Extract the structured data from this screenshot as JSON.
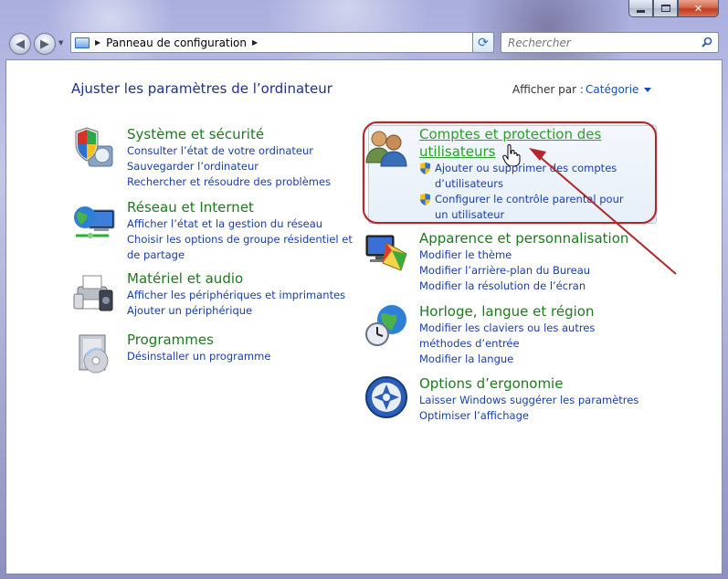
{
  "window": {
    "caption_buttons": {
      "minimize_icon": "minimize-icon",
      "maximize_icon": "maximize-icon",
      "close_icon": "close-icon"
    }
  },
  "nav": {
    "back_icon": "back-arrow-icon",
    "forward_icon": "forward-arrow-icon",
    "breadcrumb": [
      "Panneau de configuration"
    ],
    "search_placeholder": "Rechercher"
  },
  "header": {
    "title": "Ajuster les paramètres de l’ordinateur",
    "view_by_label": "Afficher par :",
    "view_by_value": "Catégorie"
  },
  "categories": {
    "system": {
      "icon": "shield-security-icon",
      "title": "Système et sécurité",
      "links": [
        "Consulter l’état de votre ordinateur",
        "Sauvegarder l’ordinateur",
        "Rechercher et résoudre des problèmes"
      ]
    },
    "network": {
      "icon": "network-globe-icon",
      "title": "Réseau et Internet",
      "links": [
        "Afficher l’état et la gestion du réseau",
        "Choisir les options de groupe résidentiel et de partage"
      ]
    },
    "hardware": {
      "icon": "printer-audio-icon",
      "title": "Matériel et audio",
      "links": [
        "Afficher les périphériques et imprimantes",
        "Ajouter un périphérique"
      ]
    },
    "programs": {
      "icon": "programs-disc-icon",
      "title": "Programmes",
      "links": [
        "Désinstaller un programme"
      ]
    },
    "accounts": {
      "icon": "user-accounts-icon",
      "title": "Comptes et protection des utilisateurs",
      "links": [
        "Ajouter ou supprimer des comptes d’utilisateurs",
        "Configurer le contrôle parental pour un utilisateur"
      ]
    },
    "appearance": {
      "icon": "appearance-monitor-icon",
      "title": "Apparence et personnalisation",
      "links": [
        "Modifier le thème",
        "Modifier l’arrière-plan du Bureau",
        "Modifier la résolution de l’écran"
      ]
    },
    "clock": {
      "icon": "clock-globe-icon",
      "title": "Horloge, langue et région",
      "links": [
        "Modifier les claviers ou les autres méthodes d’entrée",
        "Modifier la langue"
      ]
    },
    "ease": {
      "icon": "ease-of-access-icon",
      "title": "Options d’ergonomie",
      "links": [
        "Laisser Windows suggérer les paramètres",
        "Optimiser l’affichage"
      ]
    }
  },
  "colors": {
    "category_title": "#1e7a1e",
    "link": "#1a3ea8",
    "annotation": "#b3262c"
  }
}
